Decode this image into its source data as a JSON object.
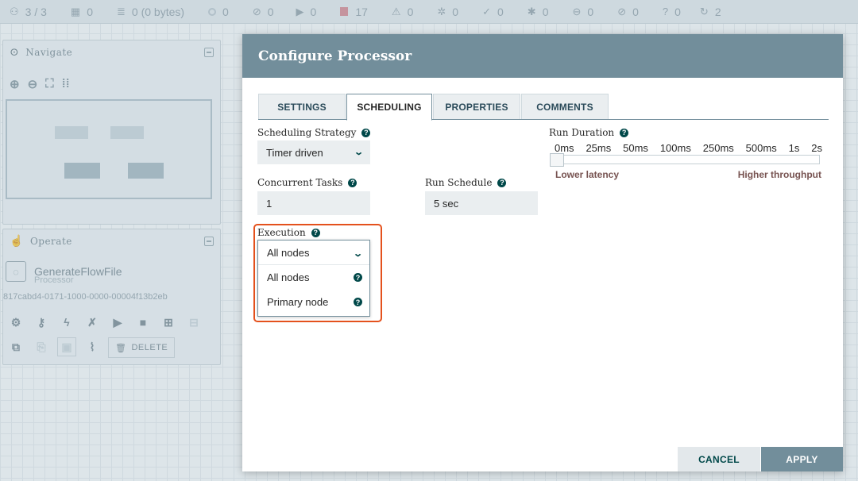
{
  "statusbar": {
    "items": [
      {
        "icon": "cluster-icon",
        "glyph": "⚇",
        "value": "3 / 3"
      },
      {
        "icon": "transmit-icon",
        "glyph": "▦",
        "value": "0"
      },
      {
        "icon": "queue-icon",
        "glyph": "≣",
        "value": "0 (0 bytes)"
      },
      {
        "icon": "running-icon",
        "glyph": "◉",
        "value": "0"
      },
      {
        "icon": "not-transmitting-icon",
        "glyph": "⊘",
        "value": "0"
      },
      {
        "icon": "play-icon",
        "glyph": "▶",
        "value": "0"
      },
      {
        "icon": "stopped-icon",
        "glyph": "■",
        "value": "17"
      },
      {
        "icon": "warning-icon",
        "glyph": "⚠",
        "value": "0"
      },
      {
        "icon": "disabled-icon",
        "glyph": "✲",
        "value": "0"
      },
      {
        "icon": "up-to-date-icon",
        "glyph": "✓",
        "value": "0"
      },
      {
        "icon": "locally-modified-icon",
        "glyph": "✱",
        "value": "0"
      },
      {
        "icon": "stale-icon",
        "glyph": "⊖",
        "value": "0"
      },
      {
        "icon": "sync-failure-icon",
        "glyph": "⊘",
        "value": "0"
      },
      {
        "icon": "unknown-icon",
        "glyph": "?",
        "value": "0"
      },
      {
        "icon": "refresh-icon",
        "glyph": "↻",
        "value": "2"
      }
    ]
  },
  "navigate": {
    "title": "Navigate",
    "tools": [
      "zoom-in-icon",
      "zoom-out-icon",
      "fit-icon",
      "actual-size-icon"
    ]
  },
  "operate": {
    "title": "Operate",
    "processor_name": "GenerateFlowFile",
    "processor_type": "Processor",
    "processor_id": "817cabd4-0171-1000-0000-00004f13b2eb",
    "delete_label": "DELETE"
  },
  "dialog": {
    "title": "Configure Processor",
    "tabs": [
      "SETTINGS",
      "SCHEDULING",
      "PROPERTIES",
      "COMMENTS"
    ],
    "active_tab": "SCHEDULING",
    "scheduling_strategy": {
      "label": "Scheduling Strategy",
      "value": "Timer driven"
    },
    "concurrent_tasks": {
      "label": "Concurrent Tasks",
      "value": "1"
    },
    "run_schedule": {
      "label": "Run Schedule",
      "value": "5 sec"
    },
    "run_duration": {
      "label": "Run Duration",
      "ticks": [
        "0ms",
        "25ms",
        "50ms",
        "100ms",
        "250ms",
        "500ms",
        "1s",
        "2s"
      ],
      "selected": "0ms",
      "low_label": "Lower latency",
      "high_label": "Higher throughput"
    },
    "execution": {
      "label": "Execution",
      "value": "All nodes",
      "options": [
        "All nodes",
        "Primary node"
      ]
    },
    "cancel_label": "CANCEL",
    "apply_label": "APPLY"
  },
  "colors": {
    "header": "#728e9b",
    "accent": "#004849",
    "highlight": "#e4511d",
    "latency_text": "#775351"
  }
}
